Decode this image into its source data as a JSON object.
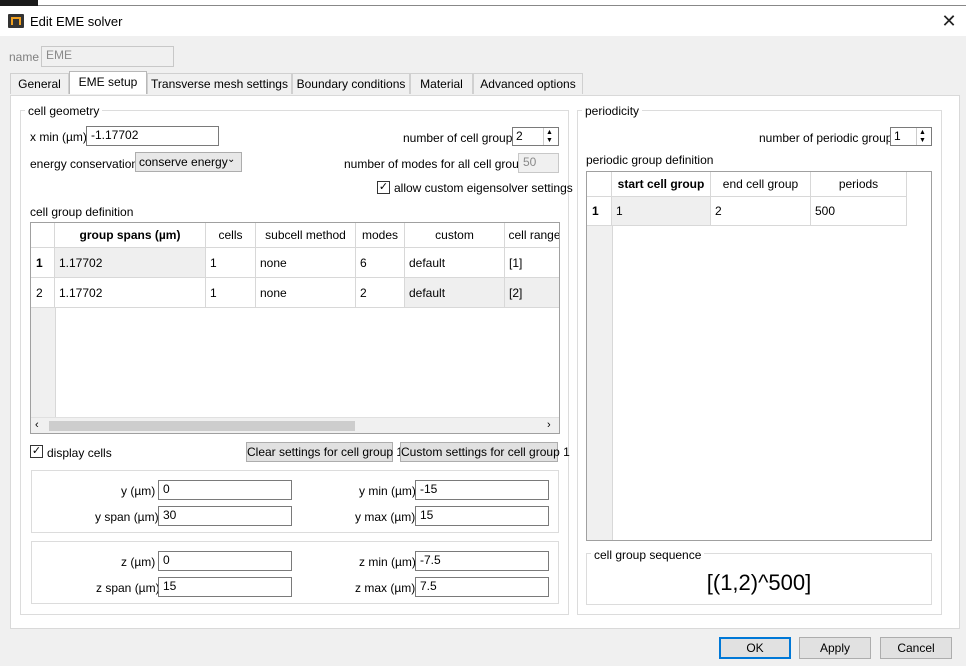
{
  "window": {
    "title": "Edit EME solver",
    "close_symbol": "✕"
  },
  "name_field": {
    "label": "name",
    "value": "EME"
  },
  "tabs": [
    {
      "label": "General"
    },
    {
      "label": "EME setup"
    },
    {
      "label": "Transverse mesh settings"
    },
    {
      "label": "Boundary conditions"
    },
    {
      "label": "Material"
    },
    {
      "label": "Advanced options"
    }
  ],
  "cell_geometry": {
    "title": "cell geometry",
    "xmin_label": "x min (µm)",
    "xmin_value": "-1.17702",
    "num_groups_label": "number of cell groups",
    "num_groups_value": "2",
    "energy_label": "energy conservation",
    "energy_value": "conserve energy",
    "modes_all_label": "number of modes for all cell groups",
    "modes_all_value": "50",
    "allow_custom_label": "allow custom eigensolver settings",
    "allow_custom_checked": true,
    "group_def_title": "cell group definition",
    "table": {
      "columns": [
        "group spans (µm)",
        "cells",
        "subcell method",
        "modes",
        "custom",
        "cell range"
      ],
      "rows": [
        {
          "index": "1",
          "cells": [
            "1.17702",
            "1",
            "none",
            "6",
            "default",
            "[1]"
          ]
        },
        {
          "index": "2",
          "cells": [
            "1.17702",
            "1",
            "none",
            "2",
            "default",
            "[2]"
          ]
        }
      ]
    },
    "display_cells_label": "display cells",
    "display_cells_checked": true,
    "clear_button": "Clear settings for cell group 1",
    "custom_button": "Custom settings for cell group 1"
  },
  "y_box": {
    "y_label": "y (µm)",
    "y_value": "0",
    "yspan_label": "y span (µm)",
    "yspan_value": "30",
    "ymin_label": "y min (µm)",
    "ymin_value": "-15",
    "ymax_label": "y max (µm)",
    "ymax_value": "15"
  },
  "z_box": {
    "z_label": "z (µm)",
    "z_value": "0",
    "zspan_label": "z span (µm)",
    "zspan_value": "15",
    "zmin_label": "z min (µm)",
    "zmin_value": "-7.5",
    "zmax_label": "z max (µm)",
    "zmax_value": "7.5"
  },
  "periodicity": {
    "title": "periodicity",
    "num_periodic_label": "number of periodic groups",
    "num_periodic_value": "1",
    "def_title": "periodic group definition",
    "table": {
      "columns": [
        "start cell group",
        "end cell group",
        "periods"
      ],
      "rows": [
        {
          "index": "1",
          "cells": [
            "1",
            "2",
            "500"
          ]
        }
      ]
    },
    "sequence_title": "cell group sequence",
    "sequence_value": "[(1,2)^500]"
  },
  "footer": {
    "ok": "OK",
    "apply": "Apply",
    "cancel": "Cancel"
  }
}
